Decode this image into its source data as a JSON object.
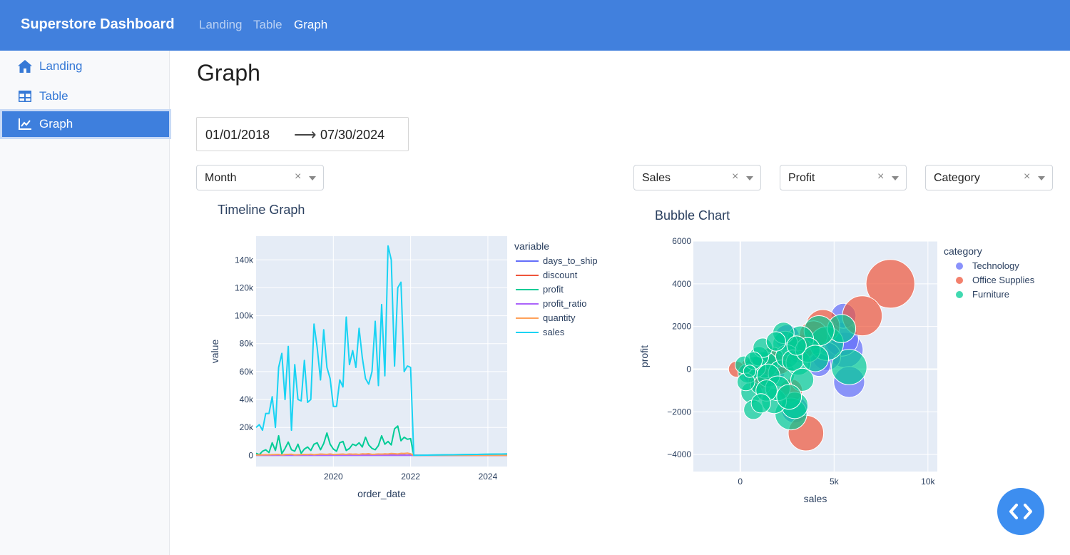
{
  "header": {
    "brand": "Superstore Dashboard",
    "nav": [
      "Landing",
      "Table",
      "Graph"
    ],
    "active": "Graph"
  },
  "sidebar": {
    "items": [
      {
        "label": "Landing",
        "icon": "home-icon"
      },
      {
        "label": "Table",
        "icon": "table-icon"
      },
      {
        "label": "Graph",
        "icon": "chart-line-icon"
      }
    ]
  },
  "page": {
    "title": "Graph",
    "date_start": "01/01/2018",
    "date_end": "07/30/2024",
    "arrow": "⟶",
    "dropdowns": {
      "period": "Month",
      "x_metric": "Sales",
      "y_metric": "Profit",
      "color": "Category"
    },
    "clear_glyph": "×"
  },
  "colors": {
    "brand": "#4180dd",
    "plot_bg": "#e5ecf6",
    "days_to_ship": "#636efa",
    "discount": "#ef553b",
    "profit": "#00cc96",
    "profit_ratio": "#ab63fa",
    "quantity": "#ffa15a",
    "sales": "#19d3f3"
  },
  "chart_data": [
    {
      "type": "line",
      "title": "Timeline Graph",
      "xlabel": "order_date",
      "ylabel": "value",
      "legend_title": "variable",
      "legend_position": "right",
      "x_range": [
        "2018-01",
        "2024-07"
      ],
      "x_ticks": [
        "2020",
        "2022",
        "2024"
      ],
      "y_ticks": [
        "0",
        "20k",
        "40k",
        "60k",
        "80k",
        "100k",
        "120k",
        "140k"
      ],
      "ylim": [
        -8000,
        157000
      ],
      "months": [
        "2018-01",
        "2018-02",
        "2018-03",
        "2018-04",
        "2018-05",
        "2018-06",
        "2018-07",
        "2018-08",
        "2018-09",
        "2018-10",
        "2018-11",
        "2018-12",
        "2019-01",
        "2019-02",
        "2019-03",
        "2019-04",
        "2019-05",
        "2019-06",
        "2019-07",
        "2019-08",
        "2019-09",
        "2019-10",
        "2019-11",
        "2019-12",
        "2020-01",
        "2020-02",
        "2020-03",
        "2020-04",
        "2020-05",
        "2020-06",
        "2020-07",
        "2020-08",
        "2020-09",
        "2020-10",
        "2020-11",
        "2020-12",
        "2021-01",
        "2021-02",
        "2021-03",
        "2021-04",
        "2021-05",
        "2021-06",
        "2021-07",
        "2021-08",
        "2021-09",
        "2021-10",
        "2021-11",
        "2021-12",
        "2022-01",
        "2022-02",
        "2024-07"
      ],
      "series": [
        {
          "name": "days_to_ship",
          "values": [
            100,
            100,
            100,
            100,
            100,
            100,
            100,
            100,
            100,
            100,
            100,
            100,
            100,
            100,
            100,
            100,
            100,
            100,
            100,
            100,
            100,
            100,
            100,
            100,
            100,
            100,
            100,
            100,
            100,
            100,
            100,
            100,
            100,
            100,
            100,
            100,
            100,
            100,
            100,
            100,
            100,
            100,
            100,
            100,
            100,
            100,
            100,
            100,
            100,
            0,
            0
          ]
        },
        {
          "name": "discount",
          "values": [
            200,
            300,
            400,
            300,
            500,
            400,
            600,
            500,
            400,
            600,
            500,
            700,
            300,
            400,
            500,
            600,
            500,
            700,
            400,
            600,
            800,
            700,
            600,
            900,
            500,
            600,
            700,
            800,
            600,
            900,
            700,
            800,
            600,
            1000,
            900,
            1100,
            600,
            700,
            900,
            800,
            1000,
            900,
            1200,
            1100,
            900,
            1300,
            1200,
            1500,
            1000,
            0,
            0
          ]
        },
        {
          "name": "profit",
          "values": [
            1500,
            500,
            3000,
            4000,
            2000,
            9000,
            3500,
            14000,
            1200,
            5000,
            9500,
            4000,
            3000,
            8000,
            1500,
            4500,
            6000,
            3500,
            8000,
            9000,
            4000,
            8500,
            16000,
            8000,
            4500,
            3000,
            9000,
            10000,
            3500,
            5000,
            8000,
            7000,
            9000,
            6000,
            13000,
            7500,
            5000,
            4000,
            7000,
            14000,
            8000,
            10000,
            7500,
            19000,
            21000,
            10500,
            13000,
            11500,
            12000,
            0,
            1000
          ]
        },
        {
          "name": "profit_ratio",
          "values": [
            0,
            0,
            0,
            0,
            0,
            0,
            0,
            0,
            0,
            0,
            0,
            0,
            0,
            0,
            0,
            0,
            0,
            0,
            0,
            0,
            0,
            0,
            0,
            0,
            0,
            0,
            0,
            0,
            0,
            0,
            0,
            0,
            0,
            0,
            0,
            0,
            0,
            0,
            0,
            0,
            0,
            0,
            0,
            0,
            0,
            0,
            0,
            0,
            0,
            0,
            0
          ]
        },
        {
          "name": "quantity",
          "values": [
            300,
            200,
            400,
            500,
            400,
            600,
            500,
            700,
            300,
            600,
            700,
            800,
            400,
            500,
            600,
            700,
            600,
            800,
            500,
            700,
            900,
            800,
            700,
            1000,
            600,
            700,
            800,
            900,
            700,
            1000,
            800,
            900,
            700,
            1100,
            1000,
            1200,
            700,
            800,
            1000,
            900,
            1100,
            1000,
            1300,
            1200,
            1000,
            1400,
            1300,
            1600,
            1100,
            0,
            0
          ]
        },
        {
          "name": "sales",
          "values": [
            20000,
            22000,
            18000,
            30000,
            30000,
            42000,
            20000,
            63000,
            73000,
            40000,
            78000,
            18000,
            65000,
            40000,
            39000,
            68000,
            38000,
            40000,
            94000,
            77000,
            54000,
            90000,
            63000,
            55000,
            35000,
            35000,
            54000,
            49000,
            99000,
            65000,
            75000,
            63000,
            91000,
            70000,
            55000,
            51000,
            60000,
            96000,
            50000,
            108000,
            57000,
            150000,
            140000,
            64000,
            120000,
            124000,
            60000,
            64000,
            63000,
            0,
            1000
          ]
        }
      ]
    },
    {
      "type": "scatter",
      "subtype": "bubble",
      "title": "Bubble Chart",
      "xlabel": "sales",
      "ylabel": "profit",
      "legend_title": "category",
      "legend_position": "right",
      "xlim": [
        -2500,
        10500
      ],
      "ylim": [
        -4800,
        6000
      ],
      "x_ticks": [
        "0",
        "5k",
        "10k"
      ],
      "y_ticks": [
        "−4000",
        "−2000",
        "0",
        "2000",
        "4000",
        "6000"
      ],
      "series": [
        {
          "name": "Technology",
          "color": "#636efa",
          "points": [
            [
              5600,
              900,
              40
            ],
            [
              5800,
              -600,
              35
            ],
            [
              5400,
              1400,
              38
            ],
            [
              4600,
              600,
              32
            ],
            [
              3800,
              1200,
              30
            ],
            [
              2500,
              1500,
              28
            ],
            [
              1800,
              -100,
              25
            ],
            [
              1200,
              400,
              22
            ],
            [
              2900,
              -1900,
              30
            ],
            [
              4200,
              200,
              26
            ],
            [
              3100,
              800,
              24
            ],
            [
              600,
              -300,
              18
            ],
            [
              5500,
              2500,
              28
            ]
          ]
        },
        {
          "name": "Office Supplies",
          "color": "#ef553b",
          "points": [
            [
              8000,
              4000,
              55
            ],
            [
              6500,
              2500,
              45
            ],
            [
              3500,
              -3000,
              40
            ],
            [
              4400,
              2000,
              38
            ],
            [
              3200,
              1000,
              30
            ],
            [
              2100,
              300,
              26
            ],
            [
              1300,
              -200,
              22
            ],
            [
              500,
              100,
              20
            ],
            [
              -200,
              0,
              18
            ],
            [
              900,
              -600,
              20
            ],
            [
              2700,
              -1000,
              26
            ],
            [
              3900,
              1600,
              32
            ],
            [
              1700,
              600,
              24
            ]
          ]
        },
        {
          "name": "Furniture",
          "color": "#00cc96",
          "points": [
            [
              5800,
              100,
              40
            ],
            [
              4600,
              1200,
              38
            ],
            [
              5400,
              1900,
              32
            ],
            [
              4200,
              1800,
              34
            ],
            [
              3200,
              1400,
              30
            ],
            [
              2400,
              1200,
              28
            ],
            [
              2700,
              -2100,
              36
            ],
            [
              2900,
              -1700,
              30
            ],
            [
              1800,
              -1500,
              28
            ],
            [
              600,
              -1100,
              24
            ],
            [
              700,
              -1900,
              22
            ],
            [
              1100,
              -700,
              24
            ],
            [
              1700,
              500,
              26
            ],
            [
              1300,
              200,
              30
            ],
            [
              2200,
              -200,
              30
            ],
            [
              2500,
              600,
              26
            ],
            [
              3100,
              300,
              28
            ],
            [
              800,
              100,
              24
            ],
            [
              400,
              -200,
              22
            ],
            [
              200,
              200,
              20
            ],
            [
              1000,
              600,
              22
            ],
            [
              1500,
              -300,
              26
            ],
            [
              2000,
              -900,
              28
            ],
            [
              300,
              -600,
              20
            ],
            [
              2800,
              400,
              24
            ],
            [
              3600,
              900,
              28
            ],
            [
              1200,
              1000,
              22
            ],
            [
              2300,
              1700,
              24
            ],
            [
              700,
              400,
              20
            ],
            [
              1900,
              1300,
              22
            ],
            [
              3300,
              -500,
              26
            ],
            [
              4000,
              500,
              30
            ],
            [
              2600,
              -1300,
              28
            ],
            [
              1400,
              -1000,
              24
            ],
            [
              500,
              -100,
              14
            ],
            [
              1100,
              -1600,
              22
            ],
            [
              3000,
              1100,
              22
            ]
          ]
        }
      ]
    }
  ]
}
